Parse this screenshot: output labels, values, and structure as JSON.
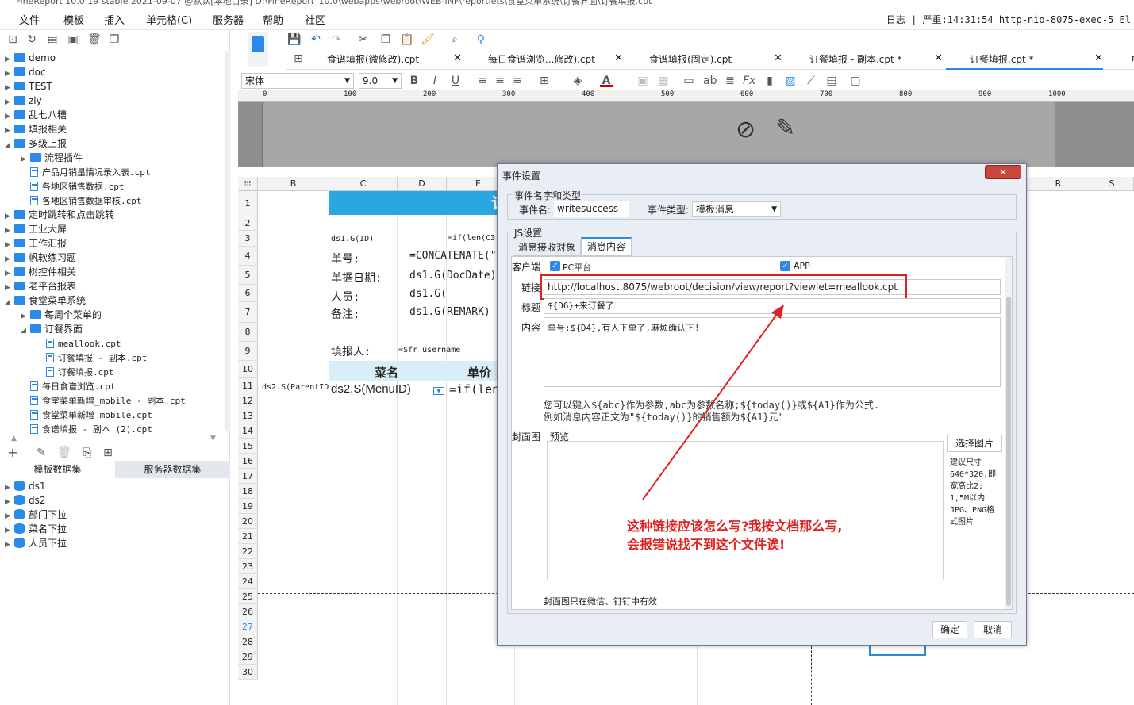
{
  "titlebar": {
    "text": "FineReport 10.0.19 stable 2021-09-07 @默认[本地目录]     D:\\FineReport_10.0\\webapps\\webroot\\WEB-INF\\reportlets\\食堂菜单系统\\订餐界面\\订餐填报.cpt"
  },
  "menubar": {
    "items": [
      "文件",
      "模板",
      "插入",
      "单元格(C)",
      "服务器",
      "帮助",
      "社区"
    ],
    "status": "日志 | 严重:14:31:54 http-nio-8075-exec-5 El"
  },
  "tree": {
    "items": [
      {
        "label": "demo",
        "type": "folder",
        "depth": 0,
        "expanded": false
      },
      {
        "label": "doc",
        "type": "folder",
        "depth": 0,
        "expanded": false
      },
      {
        "label": "TEST",
        "type": "folder",
        "depth": 0,
        "expanded": false
      },
      {
        "label": "zly",
        "type": "folder",
        "depth": 0,
        "expanded": false
      },
      {
        "label": "乱七八糟",
        "type": "folder",
        "depth": 0,
        "expanded": false
      },
      {
        "label": "填报相关",
        "type": "folder",
        "depth": 0,
        "expanded": false
      },
      {
        "label": "多级上报",
        "type": "folder",
        "depth": 0,
        "expanded": true
      },
      {
        "label": "流程插件",
        "type": "folder",
        "depth": 1,
        "expanded": false
      },
      {
        "label": "产品月销量情况录入表.cpt",
        "type": "file",
        "depth": 1
      },
      {
        "label": "各地区销售数据.cpt",
        "type": "file",
        "depth": 1
      },
      {
        "label": "各地区销售数据审核.cpt",
        "type": "file",
        "depth": 1
      },
      {
        "label": "定时跳转和点击跳转",
        "type": "folder",
        "depth": 0,
        "expanded": false
      },
      {
        "label": "工业大屏",
        "type": "folder",
        "depth": 0,
        "expanded": false
      },
      {
        "label": "工作汇报",
        "type": "folder",
        "depth": 0,
        "expanded": false
      },
      {
        "label": "帆软练习题",
        "type": "folder",
        "depth": 0,
        "expanded": false
      },
      {
        "label": "树控件相关",
        "type": "folder",
        "depth": 0,
        "expanded": false
      },
      {
        "label": "老平台报表",
        "type": "folder",
        "depth": 0,
        "expanded": false
      },
      {
        "label": "食堂菜单系统",
        "type": "folder",
        "depth": 0,
        "expanded": true
      },
      {
        "label": "每周个菜单的",
        "type": "folder",
        "depth": 1,
        "expanded": false
      },
      {
        "label": "订餐界面",
        "type": "folder",
        "depth": 1,
        "expanded": true
      },
      {
        "label": "meallook.cpt",
        "type": "file",
        "depth": 2
      },
      {
        "label": "订餐填报 - 副本.cpt",
        "type": "file",
        "depth": 2
      },
      {
        "label": "订餐填报.cpt",
        "type": "file",
        "depth": 2
      },
      {
        "label": "每日食谱浏览.cpt",
        "type": "file",
        "depth": 1
      },
      {
        "label": "食堂菜单新增_mobile - 副本.cpt",
        "type": "file",
        "depth": 1
      },
      {
        "label": "食堂菜单新增_mobile.cpt",
        "type": "file",
        "depth": 1
      },
      {
        "label": "食谱填报 - 副本 (2).cpt",
        "type": "file",
        "depth": 1
      }
    ]
  },
  "datasets": {
    "tabs": [
      "模板数据集",
      "服务器数据集"
    ],
    "items": [
      "ds1",
      "ds2",
      "部门下拉",
      "菜名下拉",
      "人员下拉"
    ]
  },
  "doctabs": [
    {
      "label": "食谱填报(微修改).cpt"
    },
    {
      "label": "每日食谱浏览...修改).cpt"
    },
    {
      "label": "食谱填报(固定).cpt"
    },
    {
      "label": "订餐填报 - 副本.cpt *"
    },
    {
      "label": "订餐填报.cpt *"
    },
    {
      "label": "m"
    }
  ],
  "format": {
    "font": "宋体",
    "size": "9.0"
  },
  "ruler": [
    "0",
    "100",
    "200",
    "300",
    "400",
    "500",
    "600",
    "700",
    "800",
    "900",
    "1000"
  ],
  "sheet": {
    "columns": [
      "B",
      "C",
      "D",
      "E",
      "R",
      "S"
    ],
    "rows": [
      "1",
      "2",
      "3",
      "4",
      "5",
      "6",
      "7",
      "8",
      "9",
      "10",
      "11",
      "12",
      "13",
      "14",
      "15",
      "16",
      "17",
      "18",
      "19",
      "20",
      "21",
      "22",
      "23",
      "24",
      "25",
      "26",
      "27",
      "28",
      "29",
      "30"
    ],
    "cells": {
      "title": "订",
      "c3": "ds1.G(ID)",
      "e3": "=if(len(C3",
      "c4": "单号:",
      "d4": "=CONCATENATE(\"",
      "c5": "单据日期:",
      "d5": "ds1.G(DocDate)",
      "c6": "人员:",
      "d6": "ds1.G(",
      "c7": "备注:",
      "d7": "ds1.G(REMARK)",
      "c8": "填报人:",
      "d8": "=$fr_username",
      "c9": "菜名",
      "e9": "单价",
      "b10": "ds2.S(ParentID",
      "c10": "ds2.S(MenuID)",
      "e10": "=if(len(C"
    }
  },
  "dialog": {
    "title": "事件设置",
    "close": "✕",
    "group_name": "事件名字和类型",
    "event_name_label": "事件名:",
    "event_name_value": "writesuccess",
    "event_type_label": "事件类型:",
    "event_type_value": "模板消息",
    "js_group": "JS设置",
    "tabs": [
      "消息接收对象",
      "消息内容"
    ],
    "client_label": "客户端",
    "pc_label": "PC平台",
    "app_label": "APP",
    "link_label": "链接",
    "link_value": "http://localhost:8075/webroot/decision/view/report?viewlet=meallook.cpt",
    "subject_label": "标题",
    "subject_value": "${D6}+来订餐了",
    "content_label": "内容",
    "content_value": "单号:${D4},有人下单了,麻烦确认下!",
    "hint1": "您可以键入${abc}作为参数,abc为参数名称;${today()}或${A1}作为公式.",
    "hint2": "例如消息内容正文为\"${today()}的销售额为${A1}元\"",
    "cover_label": "封面图",
    "preview_label": "预览",
    "choose_image": "选择图片",
    "size_hint": [
      "建议尺寸",
      "640*320,即",
      "宽高比2:",
      "1,5M以内",
      "JPG、PNG格",
      "式图片"
    ],
    "cover_note": "封面图只在微信、钉钉中有效",
    "ok": "确定",
    "cancel": "取消"
  },
  "annotation": {
    "line1": "这种链接应该怎么写?我按文档那么写,",
    "line2": "会报错说找不到这个文件诶!",
    "color": "#e02222"
  }
}
